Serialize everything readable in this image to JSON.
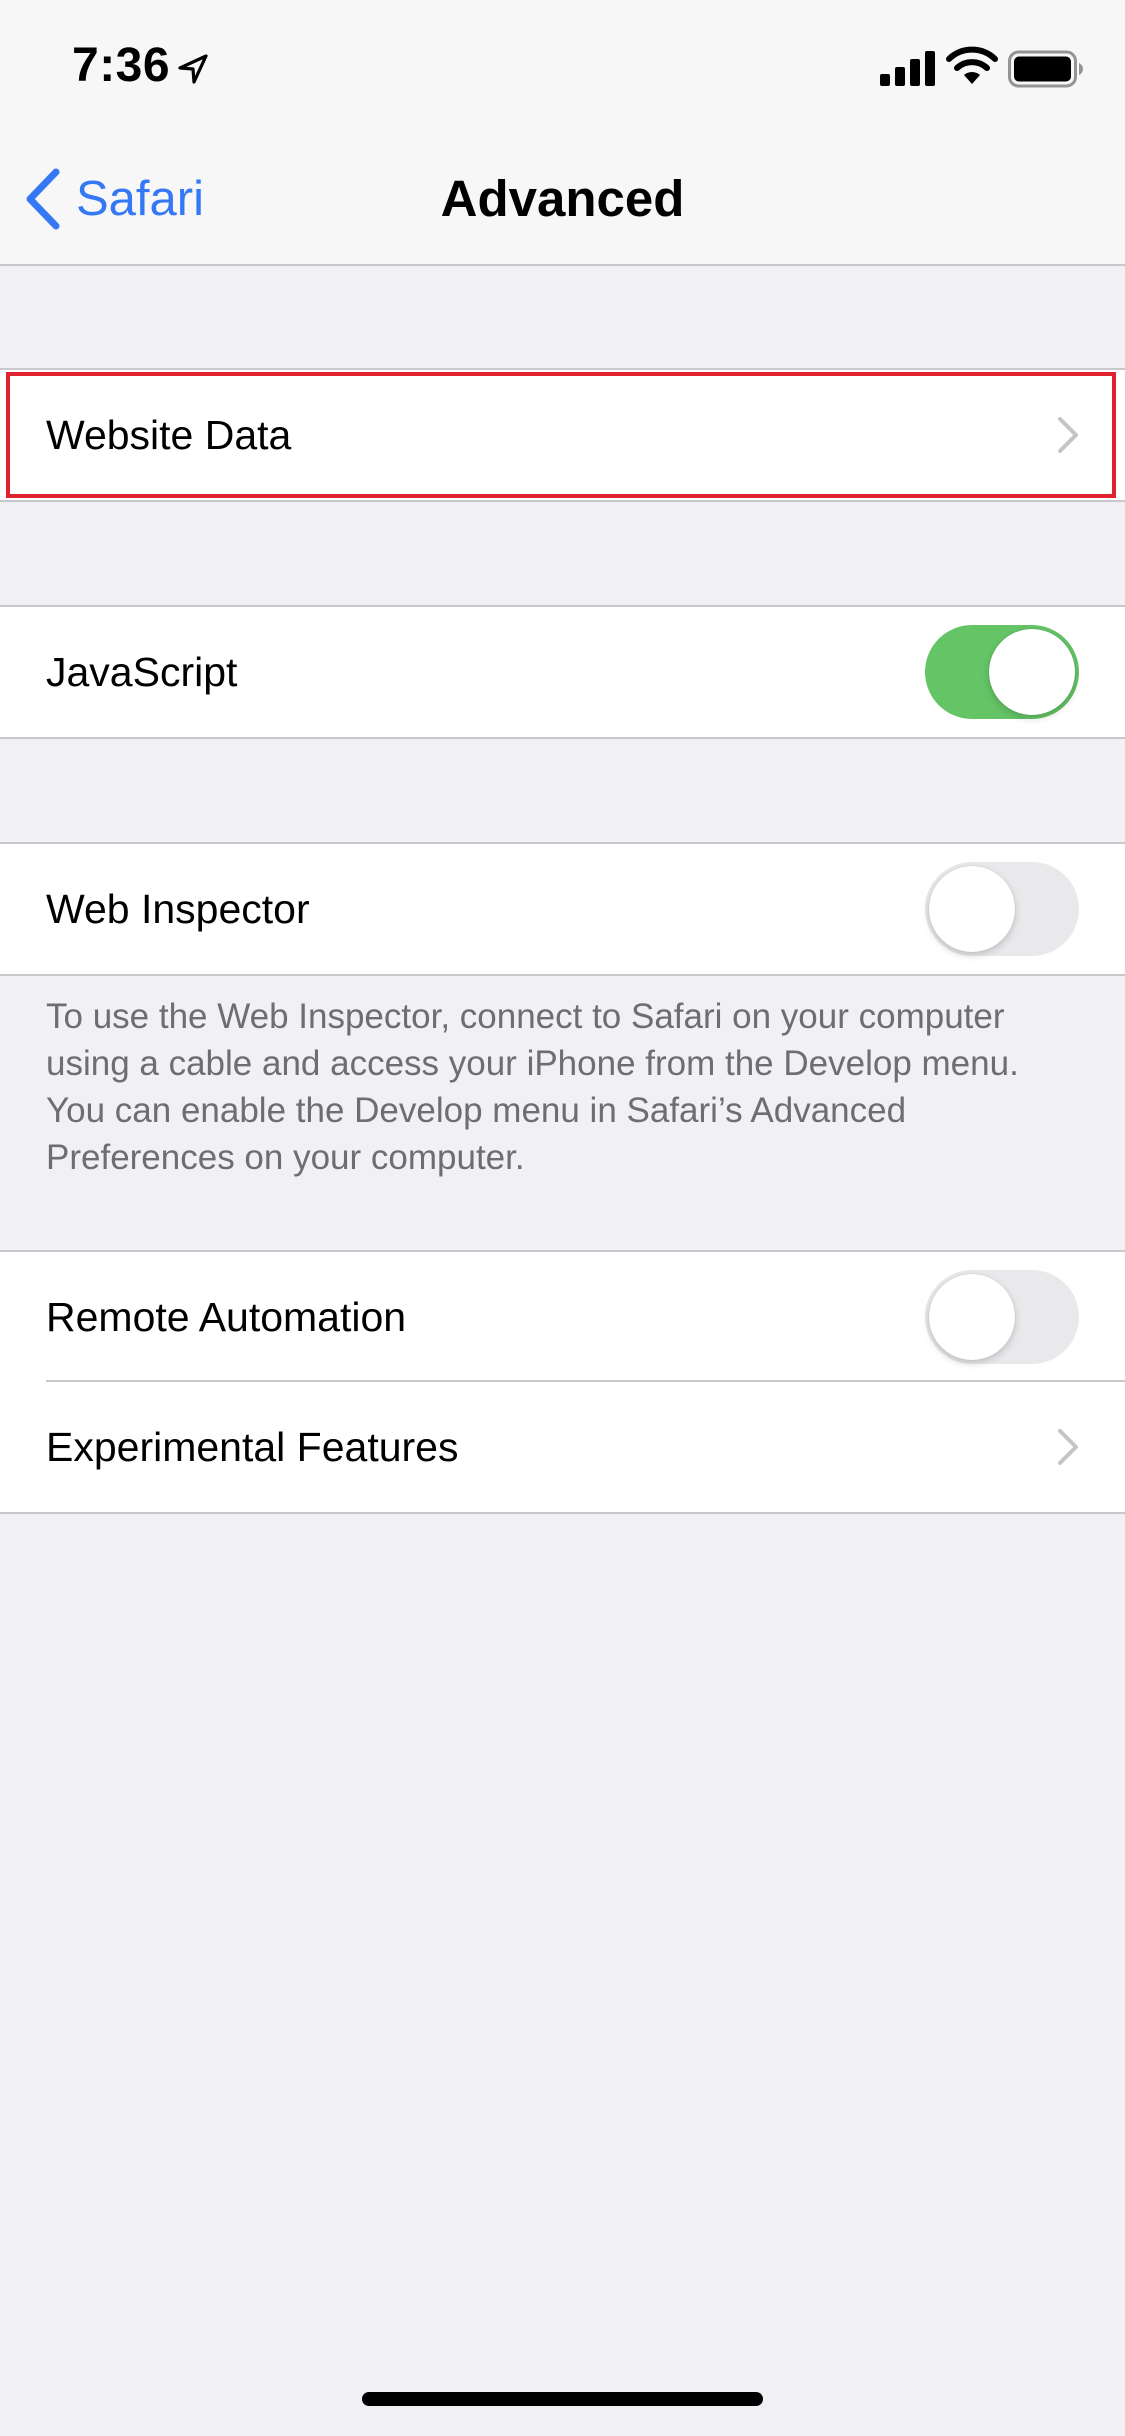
{
  "status_bar": {
    "time": "7:36"
  },
  "nav": {
    "back_label": "Safari",
    "title": "Advanced"
  },
  "cells": {
    "website_data": {
      "label": "Website Data"
    },
    "javascript": {
      "label": "JavaScript",
      "enabled": true
    },
    "web_inspector": {
      "label": "Web Inspector",
      "enabled": false
    },
    "web_inspector_footer": "To use the Web Inspector, connect to Safari on your computer using a cable and access your iPhone from the Develop menu. You can enable the Develop menu in Safari’s Advanced Preferences on your computer.",
    "remote_automation": {
      "label": "Remote Automation",
      "enabled": false
    },
    "experimental_features": {
      "label": "Experimental Features"
    }
  },
  "colors": {
    "accent": "#3478f6",
    "toggle_on": "#65c466",
    "highlight": "#e0212e"
  },
  "icons": [
    "location-icon",
    "signal-icon",
    "wifi-icon",
    "battery-icon",
    "back-chevron-icon",
    "chevron-right-icon"
  ]
}
